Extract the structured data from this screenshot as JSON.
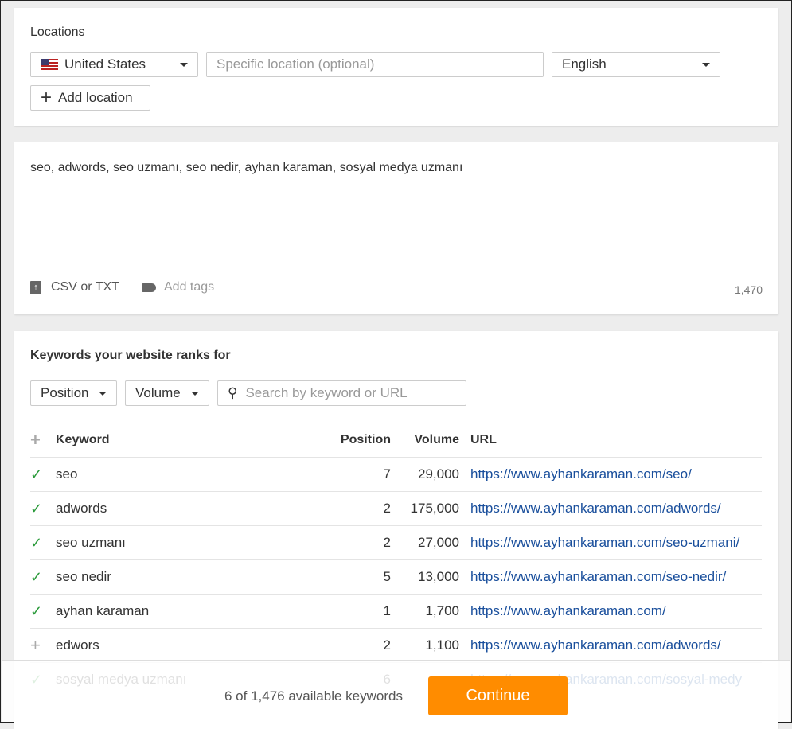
{
  "locations": {
    "label": "Locations",
    "country": "United States",
    "specific_placeholder": "Specific location (optional)",
    "language": "English",
    "add_location": "Add location"
  },
  "keywords_input": {
    "text": "seo, adwords, seo uzmanı, seo nedir, ayhan karaman, sosyal medya uzmanı",
    "csv": "CSV or TXT",
    "tags": "Add tags",
    "count": "1,470"
  },
  "ranks": {
    "title": "Keywords your website ranks for",
    "filters": {
      "position": "Position",
      "volume": "Volume",
      "search_placeholder": "Search by keyword or URL"
    },
    "columns": {
      "keyword": "Keyword",
      "position": "Position",
      "volume": "Volume",
      "url": "URL"
    },
    "rows": [
      {
        "status": "checked",
        "keyword": "seo",
        "position": "7",
        "volume": "29,000",
        "url": "https://www.ayhankaraman.com/seo/"
      },
      {
        "status": "checked",
        "keyword": "adwords",
        "position": "2",
        "volume": "175,000",
        "url": "https://www.ayhankaraman.com/adwords/"
      },
      {
        "status": "checked",
        "keyword": "seo uzmanı",
        "position": "2",
        "volume": "27,000",
        "url": "https://www.ayhankaraman.com/seo-uzmani/"
      },
      {
        "status": "checked",
        "keyword": "seo nedir",
        "position": "5",
        "volume": "13,000",
        "url": "https://www.ayhankaraman.com/seo-nedir/"
      },
      {
        "status": "checked",
        "keyword": "ayhan karaman",
        "position": "1",
        "volume": "1,700",
        "url": "https://www.ayhankaraman.com/"
      },
      {
        "status": "add",
        "keyword": "edwors",
        "position": "2",
        "volume": "1,100",
        "url": "https://www.ayhankaraman.com/adwords/"
      },
      {
        "status": "checked",
        "keyword": "sosyal medya uzmanı",
        "position": "6",
        "volume": "",
        "url": "https://www.ayhankaraman.com/sosyal-medy"
      }
    ]
  },
  "footer": {
    "summary": "6 of 1,476 available keywords",
    "continue": "Continue"
  },
  "colors": {
    "accent": "#ff8c00",
    "link": "#1a4f9c",
    "check": "#2a9a3a"
  }
}
